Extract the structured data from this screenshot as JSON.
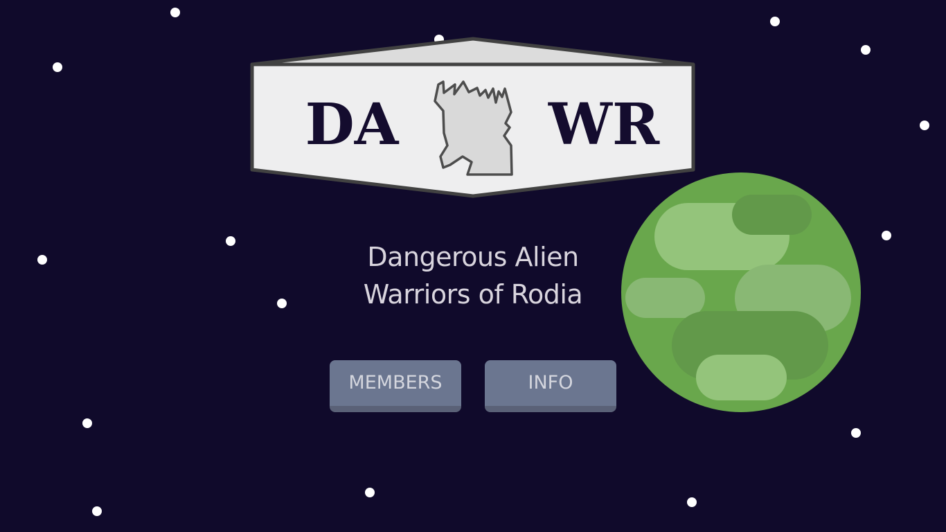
{
  "logo": {
    "left_text": "DA",
    "right_text": "WR",
    "emblem": "rodian-head-icon"
  },
  "tagline": {
    "line1": "Dangerous Alien",
    "line2": "Warriors of Rodia"
  },
  "nav": {
    "members_label": "MEMBERS",
    "info_label": "INFO"
  },
  "colors": {
    "background": "#100a2b",
    "star": "#ffffff",
    "logo_panel": "#eeeeef",
    "logo_border": "#414141",
    "logo_text": "#140c2e",
    "planet": "#69a74c",
    "button": "#6b7690",
    "button_shadow": "#5a6177",
    "text": "#d9d5de"
  }
}
